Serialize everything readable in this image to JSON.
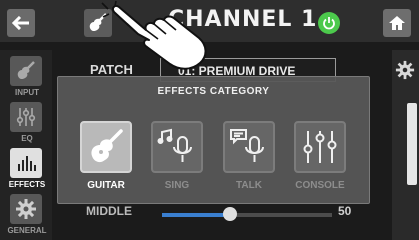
{
  "header": {
    "channel_title": "CHANNEL 1",
    "back_icon": "back-arrow-icon",
    "guitar_icon": "guitar-icon",
    "power_icon": "power-icon",
    "home_icon": "home-icon",
    "colors": {
      "power": "#4cc94c",
      "bar": "#2e2e2e"
    }
  },
  "sidebar": {
    "items": [
      {
        "label": "INPUT",
        "icon": "guitar-icon",
        "active": false
      },
      {
        "label": "EQ",
        "icon": "eq-sliders-icon",
        "active": false
      },
      {
        "label": "EFFECTS",
        "icon": "effects-meter-icon",
        "active": true
      },
      {
        "label": "GENERAL",
        "icon": "gear-icon",
        "active": false
      }
    ]
  },
  "background_screen": {
    "patch_label": "PATCH",
    "patch_value": "01: PREMIUM DRIVE",
    "middle_label": "MIDDLE",
    "middle_value": "50",
    "middle_level": 0.4
  },
  "modal": {
    "title": "EFFECTS CATEGORY",
    "categories": [
      {
        "label": "GUITAR",
        "icon": "guitar-icon",
        "selected": true
      },
      {
        "label": "SING",
        "icon": "microphone-music-icon",
        "selected": false
      },
      {
        "label": "TALK",
        "icon": "microphone-speech-icon",
        "selected": false
      },
      {
        "label": "CONSOLE",
        "icon": "mixer-console-icon",
        "selected": false
      }
    ]
  },
  "overlay": {
    "pointer_icon": "hand-pointer-icon"
  }
}
